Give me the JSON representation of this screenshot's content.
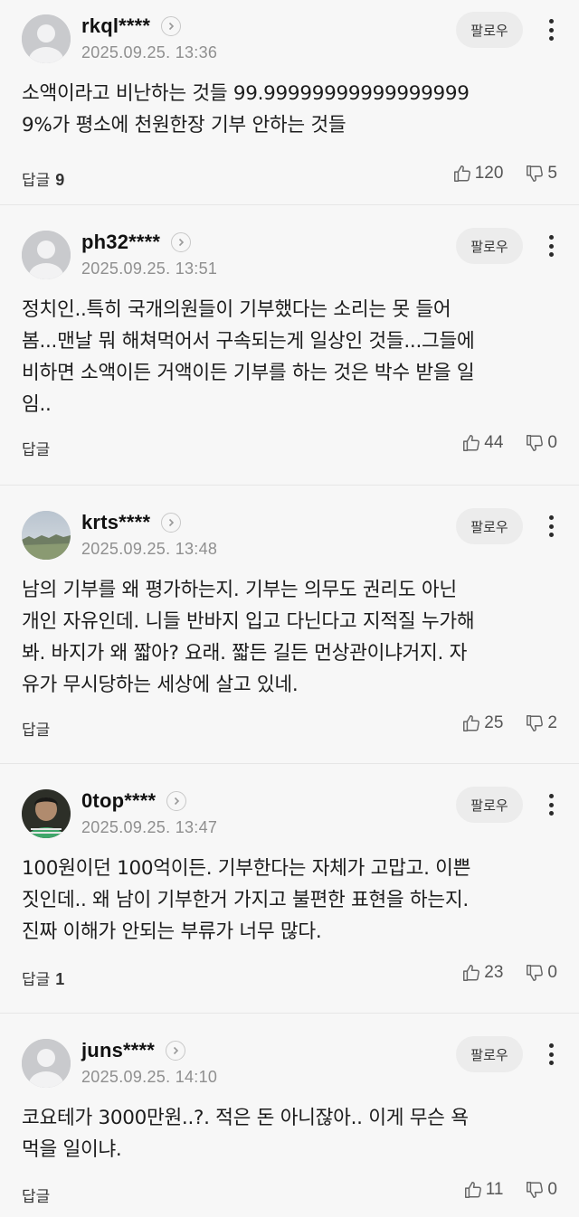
{
  "follow_label": "팔로우",
  "reply_label": "답글",
  "comments": [
    {
      "username": "rkql****",
      "date": "2025.09.25. 13:36",
      "text": "소액이라고 비난하는 것들 99.99999999999999999\n9%가 평소에 천원한장 기부 안하는 것들",
      "replies": "9",
      "likes": "120",
      "dislikes": "5",
      "avatar": "default"
    },
    {
      "username": "ph32****",
      "date": "2025.09.25. 13:51",
      "text": "정치인..특히 국개의원들이 기부했다는 소리는 못 들어\n봄...맨날 뭐 해쳐먹어서 구속되는게 일상인 것들...그들에\n비하면 소액이든 거액이든 기부를 하는 것은 박수 받을 일\n임..",
      "replies": "",
      "likes": "44",
      "dislikes": "0",
      "avatar": "default"
    },
    {
      "username": "krts****",
      "date": "2025.09.25. 13:48",
      "text": "남의 기부를 왜 평가하는지. 기부는 의무도 권리도 아닌\n개인 자유인데. 니들 반바지 입고 다닌다고 지적질 누가해\n봐. 바지가 왜 짧아? 요래. 짧든 길든 먼상관이냐거지. 자\n유가 무시당하는 세상에 살고 있네.",
      "replies": "",
      "likes": "25",
      "dislikes": "2",
      "avatar": "landscape"
    },
    {
      "username": "0top****",
      "date": "2025.09.25. 13:47",
      "text": "100원이던 100억이든. 기부한다는 자체가 고맙고. 이쁜\n짓인데.. 왜 남이 기부한거 가지고 불편한 표현을 하는지.\n진짜 이해가 안되는 부류가 너무 많다.",
      "replies": "1",
      "likes": "23",
      "dislikes": "0",
      "avatar": "person"
    },
    {
      "username": "juns****",
      "date": "2025.09.25. 14:10",
      "text": "코요테가 3000만원..?. 적은 돈 아니잖아.. 이게 무슨 욕\n먹을 일이냐.",
      "replies": "",
      "likes": "11",
      "dislikes": "0",
      "avatar": "default"
    }
  ]
}
